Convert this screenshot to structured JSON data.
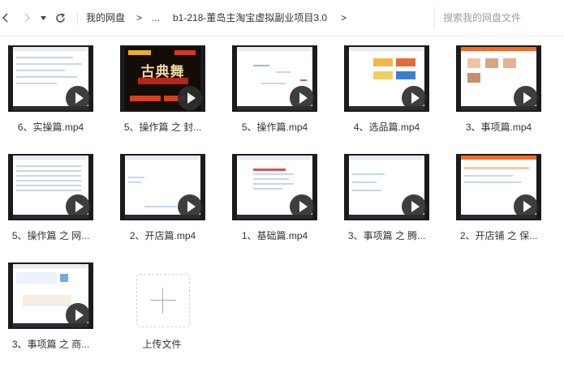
{
  "toolbar": {
    "breadcrumb": [
      {
        "label": "我的网盘"
      },
      {
        "label": ">"
      },
      {
        "label": "..."
      },
      {
        "label": "b1-218-董岛主淘宝虚拟副业项目3.0"
      },
      {
        "label": ">"
      }
    ],
    "search_placeholder": "搜索我的网盘文件"
  },
  "files": [
    {
      "name": "6、实操篇.mp4",
      "icon": "video-thumbnail"
    },
    {
      "name": "5、操作篇 之 封...",
      "icon": "video-thumbnail",
      "poster_title": "古典舞"
    },
    {
      "name": "5、操作篇.mp4",
      "icon": "video-thumbnail"
    },
    {
      "name": "4、选品篇.mp4",
      "icon": "video-thumbnail"
    },
    {
      "name": "3、事项篇.mp4",
      "icon": "video-thumbnail"
    },
    {
      "name": "5、操作篇 之 网...",
      "icon": "video-thumbnail"
    },
    {
      "name": "2、开店篇.mp4",
      "icon": "video-thumbnail"
    },
    {
      "name": "1、基础篇.mp4",
      "icon": "video-thumbnail"
    },
    {
      "name": "3、事项篇 之 腾...",
      "icon": "video-thumbnail"
    },
    {
      "name": "2、开店铺 之 保...",
      "icon": "video-thumbnail"
    },
    {
      "name": "3、事项篇 之 商...",
      "icon": "video-thumbnail"
    }
  ],
  "upload": {
    "label": "上传文件",
    "icon": "plus-icon"
  },
  "colors": {
    "thumb_frame": "#1b1b1b",
    "poster_text": "#f1d9a3",
    "accent_red": "#d6401c"
  }
}
